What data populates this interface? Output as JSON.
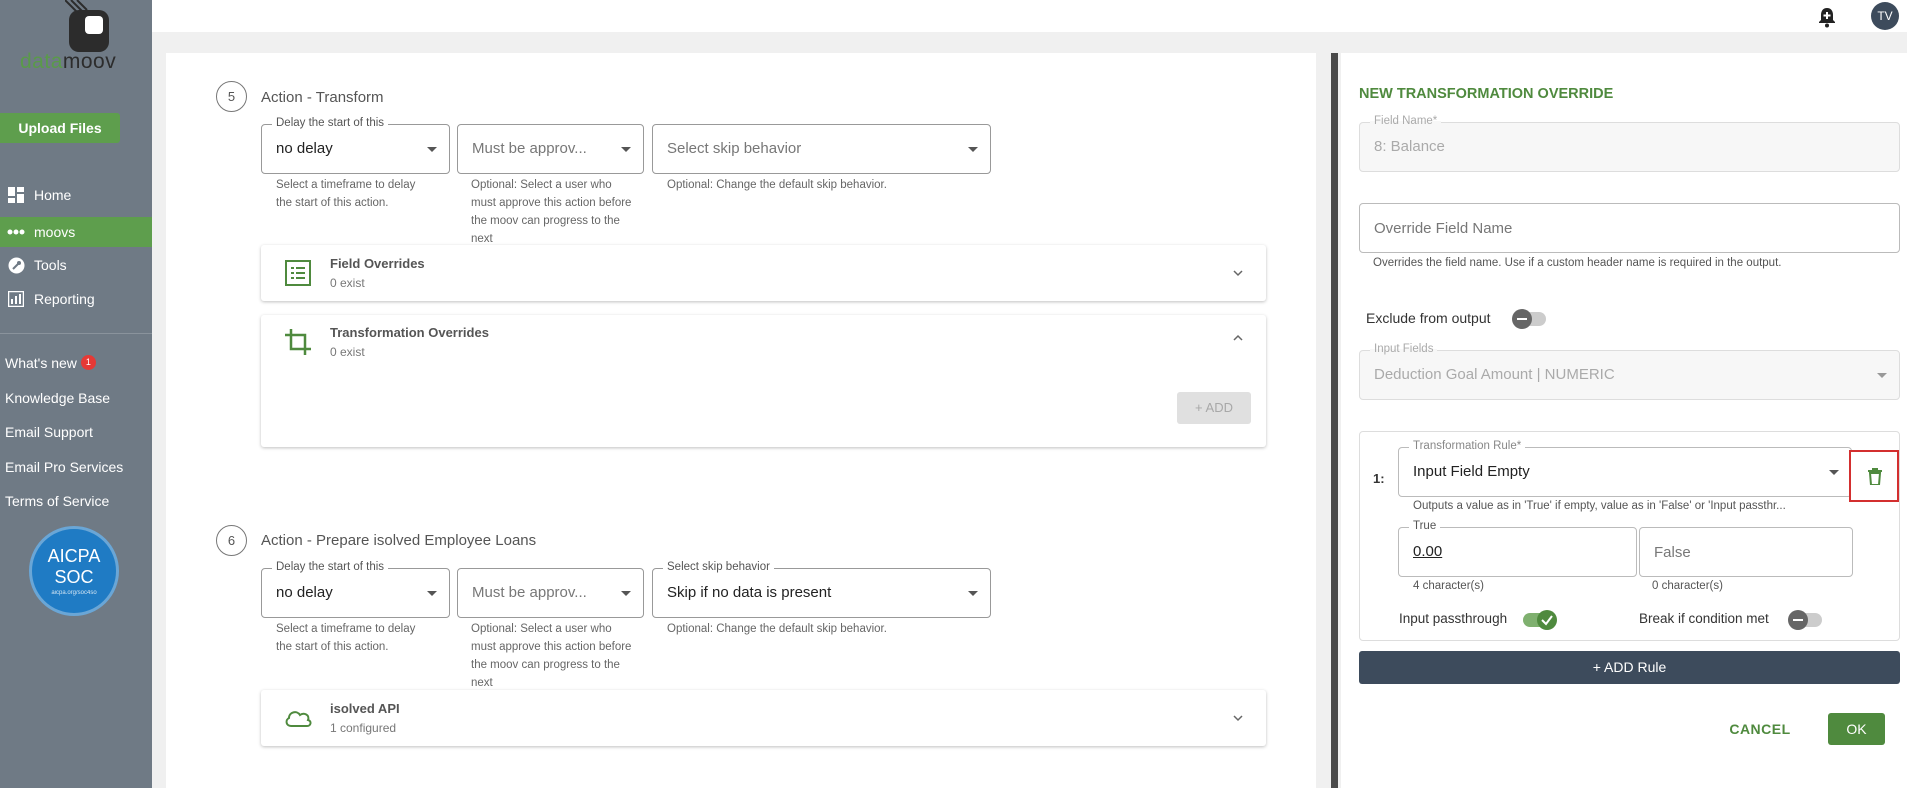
{
  "brand": {
    "logo_part1": "data",
    "logo_part2": "moov"
  },
  "sidebar": {
    "upload_label": "Upload Files",
    "nav": [
      {
        "label": "Home",
        "icon": "dashboard-icon"
      },
      {
        "label": "moovs",
        "icon": "dots-icon"
      },
      {
        "label": "Tools",
        "icon": "wrench-icon"
      },
      {
        "label": "Reporting",
        "icon": "chart-icon"
      }
    ],
    "links": [
      {
        "label": "What's new",
        "badge": "1"
      },
      {
        "label": "Knowledge Base"
      },
      {
        "label": "Email Support"
      },
      {
        "label": "Email Pro Services"
      },
      {
        "label": "Terms of Service"
      }
    ],
    "cert": {
      "line1": "AICPA",
      "line2": "SOC",
      "line3": "aicpa.org/soc4so"
    }
  },
  "topbar": {
    "avatar_initials": "TV"
  },
  "steps": [
    {
      "number": "5",
      "title": "Action - Transform",
      "delay": {
        "label": "Delay the start of this",
        "value": "no delay",
        "help": "Select a timeframe to delay the start of this action."
      },
      "approval": {
        "placeholder": "Must be approv...",
        "help": "Optional: Select a user who must approve this action before the moov can progress to the next"
      },
      "skip": {
        "label": "",
        "placeholder": "Select skip behavior",
        "value": "",
        "help": "Optional: Change the default skip behavior."
      },
      "cards": [
        {
          "title": "Field Overrides",
          "subtitle": "0 exist"
        },
        {
          "title": "Transformation Overrides",
          "subtitle": "0 exist",
          "add_label": "+ ADD"
        }
      ]
    },
    {
      "number": "6",
      "title": "Action - Prepare isolved Employee Loans",
      "delay": {
        "label": "Delay the start of this",
        "value": "no delay",
        "help": "Select a timeframe to delay the start of this action."
      },
      "approval": {
        "placeholder": "Must be approv...",
        "help": "Optional: Select a user who must approve this action before the moov can progress to the next"
      },
      "skip": {
        "label": "Select skip behavior",
        "value": "Skip if no data is present",
        "help": "Optional: Change the default skip behavior."
      },
      "cards": [
        {
          "title": "isolved API",
          "subtitle": "1 configured"
        }
      ]
    }
  ],
  "override_panel": {
    "title": "NEW TRANSFORMATION OVERRIDE",
    "field_name": {
      "label": "Field Name*",
      "value": "8: Balance"
    },
    "override_field_name": {
      "placeholder": "Override Field Name",
      "help": "Overrides the field name. Use if a custom header name is required in the output."
    },
    "exclude_label": "Exclude from output",
    "input_fields": {
      "label": "Input Fields",
      "value": "Deduction Goal Amount | NUMERIC"
    },
    "rule": {
      "index_label": "1:",
      "label": "Transformation Rule*",
      "value": "Input Field Empty",
      "help": "Outputs a value as in 'True' if empty, value as in 'False' or 'Input passthr...",
      "true_label": "True",
      "true_value": "0.00",
      "true_count": "4 character(s)",
      "false_placeholder": "False",
      "false_count": "0 character(s)",
      "passthrough_label": "Input passthrough",
      "passthrough_on": true,
      "break_label": "Break if condition met",
      "break_on": false
    },
    "add_rule_label": "+ ADD Rule",
    "cancel_label": "CANCEL",
    "ok_label": "OK"
  }
}
